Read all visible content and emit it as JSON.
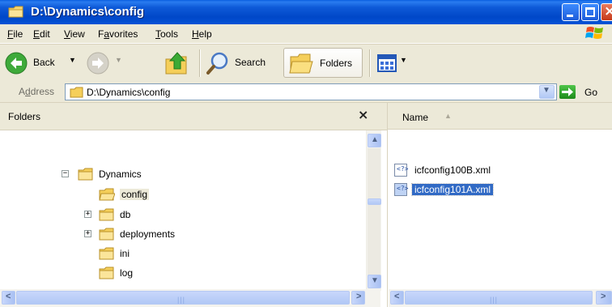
{
  "window": {
    "title": "D:\\Dynamics\\config"
  },
  "menu": [
    {
      "label": "File",
      "key": "F",
      "rest": "ile"
    },
    {
      "label": "Edit",
      "key": "E",
      "rest": "dit"
    },
    {
      "label": "View",
      "key": "V",
      "rest": "iew"
    },
    {
      "label": "Favorites",
      "key": "a",
      "pre": "F",
      "rest": "vorites"
    },
    {
      "label": "Tools",
      "key": "T",
      "rest": "ools"
    },
    {
      "label": "Help",
      "key": "H",
      "rest": "elp"
    }
  ],
  "toolbar": {
    "back": "Back",
    "search": "Search",
    "folders": "Folders"
  },
  "address": {
    "label": "Address",
    "label_key": "d",
    "path": "D:\\Dynamics\\config",
    "go": "Go"
  },
  "folders_pane": {
    "title": "Folders",
    "close": "×",
    "tree": [
      {
        "label": "Dynamics",
        "expander": "−"
      },
      {
        "label": "config",
        "expander": "",
        "selected": true
      },
      {
        "label": "db",
        "expander": "+"
      },
      {
        "label": "deployments",
        "expander": "+"
      },
      {
        "label": "ini",
        "expander": ""
      },
      {
        "label": "log",
        "expander": ""
      }
    ]
  },
  "files_pane": {
    "column_name": "Name",
    "files": [
      {
        "name": "icfconfig100B.xml",
        "selected": false
      },
      {
        "name": "icfconfig101A.xml",
        "selected": true
      }
    ]
  },
  "colors": {
    "titlebar": "#0047C8",
    "selection": "#316AC5",
    "chrome": "#ECE9D8"
  }
}
